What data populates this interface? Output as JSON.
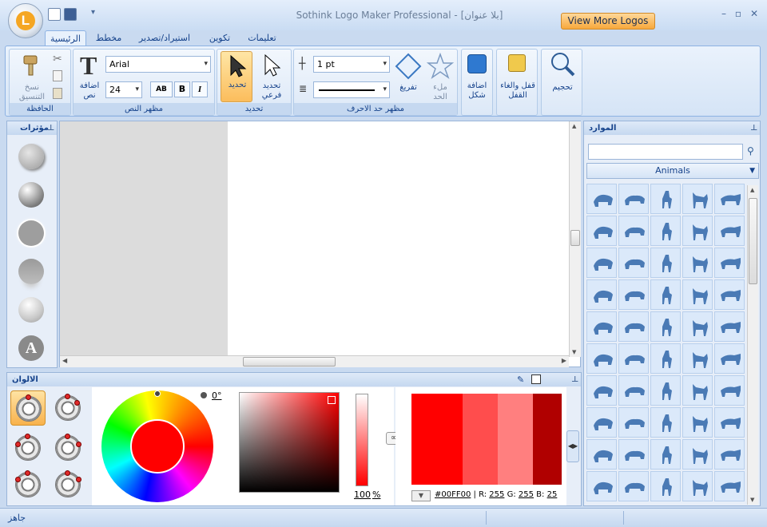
{
  "window": {
    "title": "Sothink Logo Maker Professional - [بلا عنوان]",
    "view_more": "View More Logos"
  },
  "tabs": [
    "الرئيسية",
    "مخطط",
    "استيراد/تصدير",
    "تكوين",
    "تعليمات"
  ],
  "ribbon": {
    "clipboard": {
      "format_painter": "نسخ التنسيق",
      "group": "الحافظة"
    },
    "text": {
      "add_text": "اضافة نص",
      "font": "Arial",
      "size": "24",
      "bold": "B",
      "italic": "I",
      "ab": "AB",
      "group": "مظهر النص"
    },
    "select": {
      "select": "تحديد",
      "subselect": "تحديد فرعي",
      "group": "تحديد"
    },
    "stroke": {
      "width": "1 pt",
      "fill": "تفريغ",
      "fill_stroke": "ملء الحد",
      "group": "مظهر حد الاحرف"
    },
    "shape": {
      "add_shape": "اضافة شكل"
    },
    "lock": {
      "label": "قفل والغاء القفل"
    },
    "zoom": {
      "label": "تحجيم"
    }
  },
  "effects_panel": {
    "title": "مؤثرات"
  },
  "colors_panel": {
    "title": "الالوان",
    "angle": "0°",
    "alpha_value": "100",
    "alpha_unit": "%",
    "hex": "#00FF00",
    "r_label": "R:",
    "r": "255",
    "g_label": "G:",
    "g": "255",
    "b_label": "B:",
    "b": "25"
  },
  "resources_panel": {
    "title": "الموارد",
    "search_placeholder": "",
    "category": "Animals"
  },
  "status": {
    "text": "جاهز"
  },
  "colors": {
    "accent_orange": "#f7a83c",
    "ribbon_blue": "#c9daf0",
    "icon_blue": "#4a7ab5",
    "main_red": "#ff0000"
  }
}
